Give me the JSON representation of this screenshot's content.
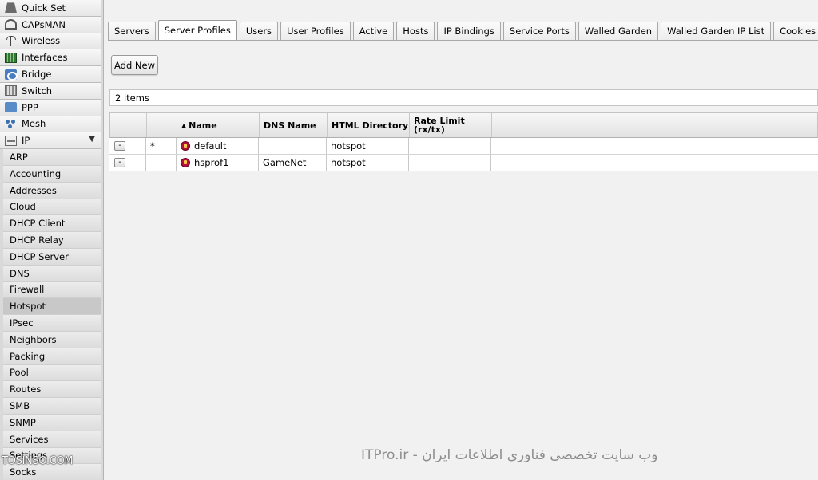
{
  "sidebar": {
    "items": [
      {
        "label": "Quick Set",
        "icon": "quick-set-icon"
      },
      {
        "label": "CAPsMAN",
        "icon": "capsman-icon"
      },
      {
        "label": "Wireless",
        "icon": "wireless-icon"
      },
      {
        "label": "Interfaces",
        "icon": "interfaces-icon"
      },
      {
        "label": "Bridge",
        "icon": "bridge-icon"
      },
      {
        "label": "Switch",
        "icon": "switch-icon"
      },
      {
        "label": "PPP",
        "icon": "ppp-icon"
      },
      {
        "label": "Mesh",
        "icon": "mesh-icon"
      },
      {
        "label": "IP",
        "icon": "ip-icon",
        "expanded_glyph": "▼"
      }
    ],
    "ip_subitems": [
      "ARP",
      "Accounting",
      "Addresses",
      "Cloud",
      "DHCP Client",
      "DHCP Relay",
      "DHCP Server",
      "DNS",
      "Firewall",
      "Hotspot",
      "IPsec",
      "Neighbors",
      "Packing",
      "Pool",
      "Routes",
      "SMB",
      "SNMP",
      "Services",
      "Settings",
      "Socks"
    ],
    "active_subitem": "Hotspot"
  },
  "tabs": [
    "Servers",
    "Server Profiles",
    "Users",
    "User Profiles",
    "Active",
    "Hosts",
    "IP Bindings",
    "Service Ports",
    "Walled Garden",
    "Walled Garden IP List",
    "Cookies"
  ],
  "active_tab": "Server Profiles",
  "toolbar": {
    "add_new_label": "Add New"
  },
  "item_count": "2 items",
  "table": {
    "headers": {
      "sort_glyph": "▲",
      "name": "Name",
      "dns_name": "DNS Name",
      "html_directory": "HTML Directory",
      "rate_limit": "Rate Limit (rx/tx)"
    },
    "rows": [
      {
        "remove": "-",
        "flag": "*",
        "name": "default",
        "dns_name": "",
        "html_directory": "hotspot",
        "rate_limit": ""
      },
      {
        "remove": "-",
        "flag": "",
        "name": "hsprof1",
        "dns_name": "GameNet",
        "html_directory": "hotspot",
        "rate_limit": ""
      }
    ]
  },
  "watermark_text": "ITPro.ir - وب سایت تخصصی فناوری اطلاعات ایران",
  "site_mark": "TOSINSO.COM"
}
